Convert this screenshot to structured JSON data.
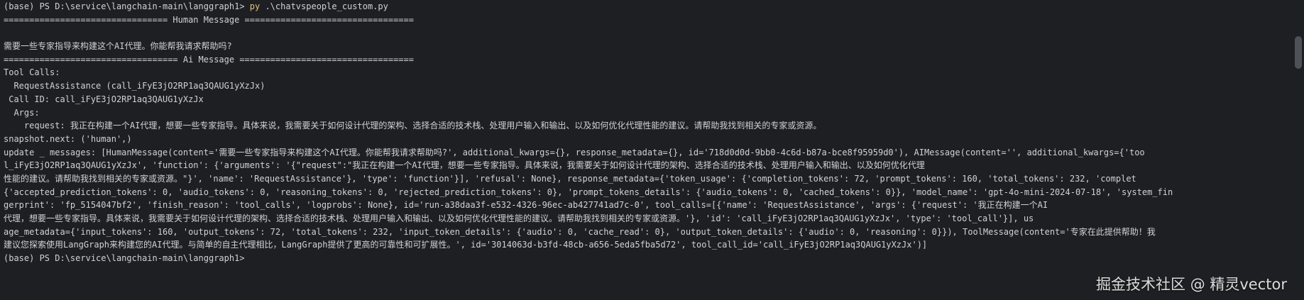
{
  "terminal": {
    "prompt": {
      "prefix": "(base) PS D:\\service\\langchain-main\\langgraph1> ",
      "cmd": "py",
      "args": " .\\chatvspeople_custom.py"
    },
    "lines": [
      "================================ Human Message =================================",
      "",
      "需要一些专家指导来构建这个AI代理。你能帮我请求帮助吗?",
      "================================== Ai Message ==================================",
      "Tool Calls:",
      "  RequestAssistance (call_iFyE3jO2RP1aq3QAUG1yXzJx)",
      " Call ID: call_iFyE3jO2RP1aq3QAUG1yXzJx",
      "  Args:",
      "    request: 我正在构建一个AI代理，想要一些专家指导。具体来说，我需要关于如何设计代理的架构、选择合适的技术栈、处理用户输入和输出、以及如何优化代理性能的建议。请帮助我找到相关的专家或资源。",
      "snapshot.next: ('human',)",
      "update _ messages: [HumanMessage(content='需要一些专家指导来构建这个AI代理。你能帮我请求帮助吗?', additional_kwargs={}, response_metadata={}, id='718d0d0d-9bb0-4c6d-b87a-bce8f95959d0'), AIMessage(content='', additional_kwargs={'too",
      "l_iFyE3jO2RP1aq3QAUG1yXzJx', 'function': {'arguments': '{\"request\":\"我正在构建一个AI代理，想要一些专家指导。具体来说，我需要关于如何设计代理的架构、选择合适的技术栈、处理用户输入和输出、以及如何优化代理",
      "性能的建议。请帮助我找到相关的专家或资源。\"}', 'name': 'RequestAssistance'}, 'type': 'function'}], 'refusal': None}, response_metadata={'token_usage': {'completion_tokens': 72, 'prompt_tokens': 160, 'total_tokens': 232, 'complet",
      "{'accepted_prediction_tokens': 0, 'audio_tokens': 0, 'reasoning_tokens': 0, 'rejected_prediction_tokens': 0}, 'prompt_tokens_details': {'audio_tokens': 0, 'cached_tokens': 0}}, 'model_name': 'gpt-4o-mini-2024-07-18', 'system_fin",
      "gerprint': 'fp_5154047bf2', 'finish_reason': 'tool_calls', 'logprobs': None}, id='run-a38daa3f-e532-4326-96ec-ab427741ad7c-0', tool_calls=[{'name': 'RequestAssistance', 'args': {'request': '我正在构建一个AI",
      "代理，想要一些专家指导。具体来说，我需要关于如何设计代理的架构、选择合适的技术栈、处理用户输入和输出、以及如何优化代理性能的建议。请帮助我找到相关的专家或资源。'}, 'id': 'call_iFyE3jO2RP1aq3QAUG1yXzJx', 'type': 'tool_call'}], us",
      "age_metadata={'input_tokens': 160, 'output_tokens': 72, 'total_tokens': 232, 'input_token_details': {'audio': 0, 'cache_read': 0}, 'output_token_details': {'audio': 0, 'reasoning': 0}}), ToolMessage(content='专家在此提供帮助！我",
      "建议您探索使用LangGraph来构建您的AI代理。与简单的自主代理相比，LangGraph提供了更高的可靠性和可扩展性。', id='3014063d-b3fd-48cb-a656-5eda5fba5d72', tool_call_id='call_iFyE3jO2RP1aq3QAUG1yXzJx')]",
      "(base) PS D:\\service\\langchain-main\\langgraph1> "
    ]
  },
  "watermark": {
    "text": "掘金技术社区 @ 精灵vector"
  },
  "colors": {
    "background": "#1e1f22",
    "foreground": "#cfd2d6",
    "command": "#e5c07b"
  }
}
